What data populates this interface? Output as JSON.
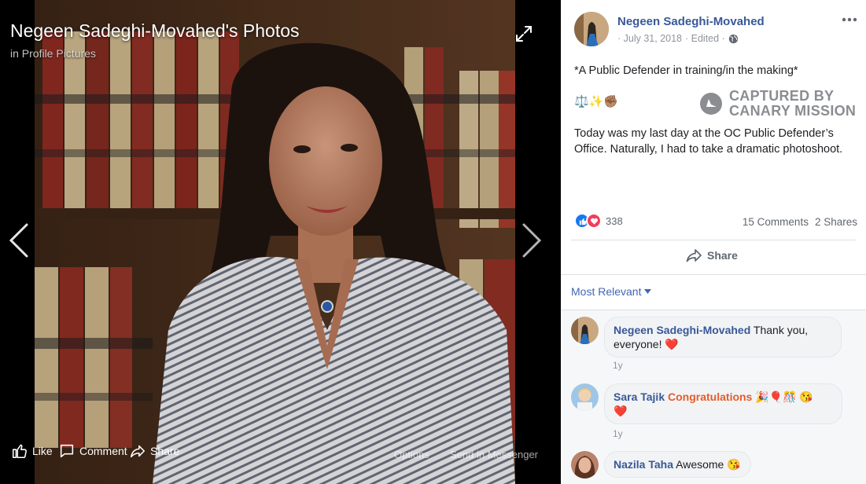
{
  "viewer": {
    "title": "Negeen Sadeghi-Movahed's Photos",
    "album": "in Profile Pictures",
    "actions": {
      "like": "Like",
      "comment": "Comment",
      "share": "Share",
      "options": "Options",
      "send_messenger": "Send in Messenger"
    },
    "icons": [
      "expand-icon",
      "chevron-left-icon",
      "chevron-right-icon",
      "thumbs-up-icon",
      "comment-icon",
      "share-icon"
    ]
  },
  "post": {
    "author": "Negeen Sadeghi-Movahed",
    "date": "July 31, 2018",
    "edited": "Edited",
    "line1": "*A Public Defender in training/in the making*",
    "emojis": "⚖️✨✊🏽",
    "body": "Today was my last day at the OC Public Defender’s Office. Naturally, I had to take a dramatic photoshoot.",
    "reaction_count": "338",
    "comments_count": "15 Comments",
    "shares_count": "2 Shares",
    "share_label": "Share"
  },
  "watermark": {
    "line1": "CAPTURED BY",
    "line2": "CANARY MISSION"
  },
  "sort": {
    "label": "Most Relevant"
  },
  "comments": [
    {
      "name": "Negeen Sadeghi-Movahed",
      "text": "Thank you, everyone!",
      "emoji": "❤️",
      "time": "1y"
    },
    {
      "name": "Sara Tajik",
      "text": "Congratulations",
      "emoji": "🎉🎈🎊 😘",
      "emoji2": "❤️",
      "time": "1y"
    },
    {
      "name": "Nazila Taha",
      "text": "Awesome",
      "emoji": "😘"
    }
  ],
  "colors": {
    "link": "#385898",
    "accent": "#4267b2",
    "like": "#1877f2",
    "love": "#f33e58"
  }
}
